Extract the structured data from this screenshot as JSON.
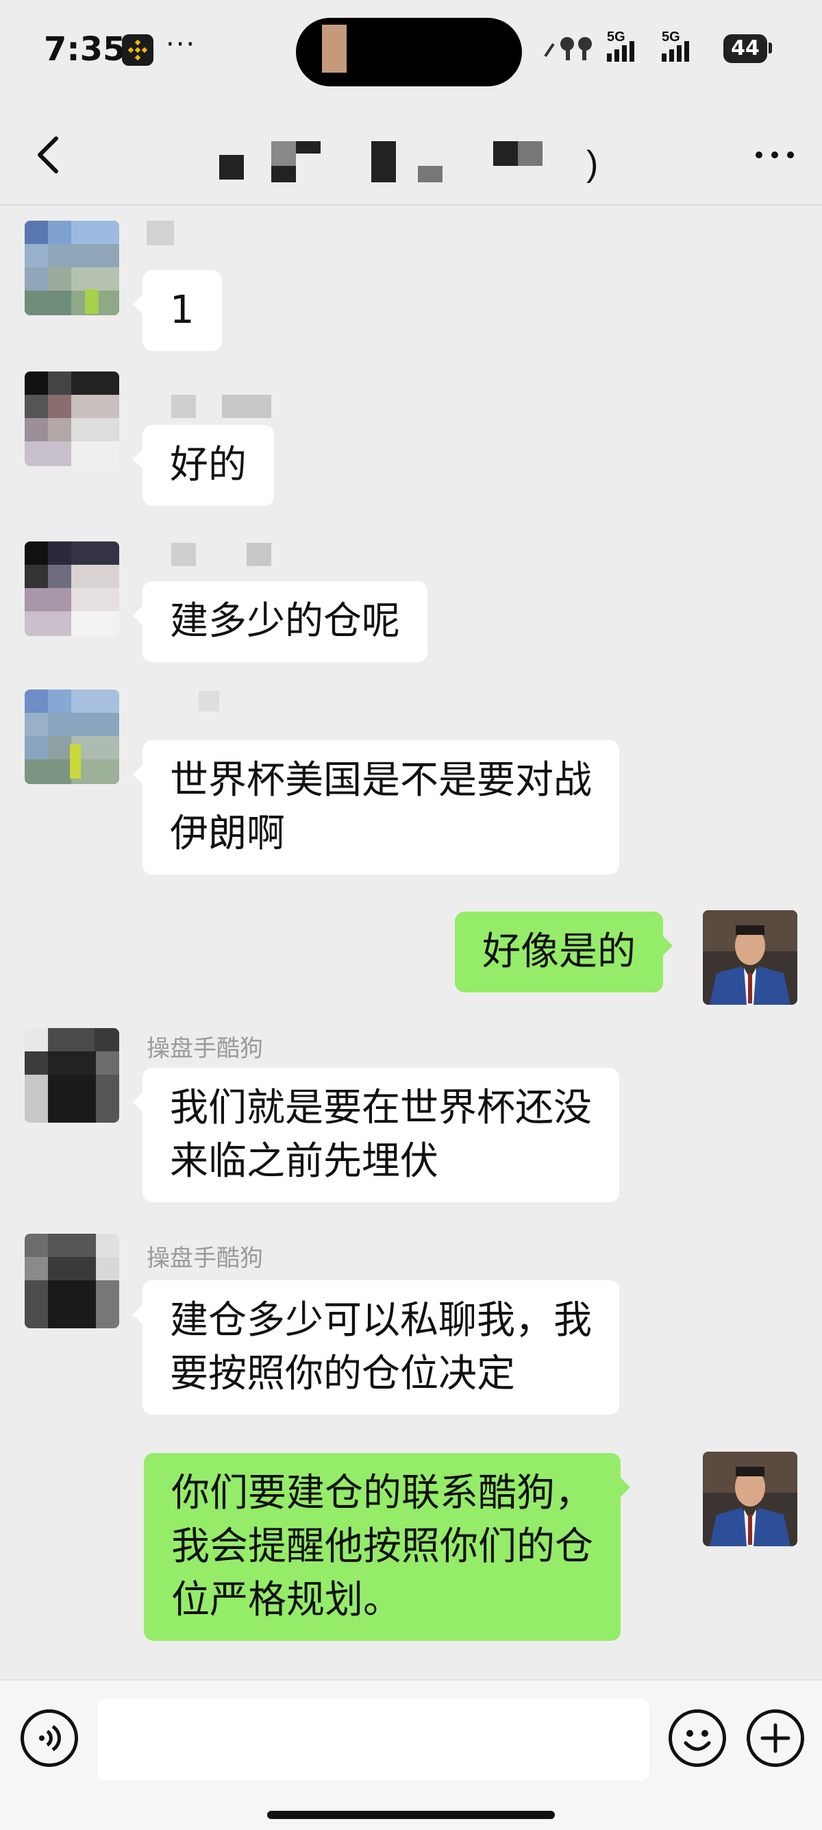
{
  "status_bar": {
    "time": "7:35",
    "more_dots": "···",
    "network_1": "5G",
    "network_2": "5G",
    "battery": "44"
  },
  "nav": {
    "more_label": "···"
  },
  "messages": [
    {
      "side": "in",
      "sender": "",
      "text_lines": [
        "1"
      ]
    },
    {
      "side": "in",
      "sender": "",
      "text_lines": [
        "好的"
      ]
    },
    {
      "side": "in",
      "sender": "",
      "text_lines": [
        "建多少的仓呢"
      ]
    },
    {
      "side": "in",
      "sender": "",
      "text_lines": [
        "世界杯美国是不是要对战",
        "伊朗啊"
      ]
    },
    {
      "side": "out",
      "sender": "",
      "text_lines": [
        "好像是的"
      ]
    },
    {
      "side": "in",
      "sender": "操盘手酷狗",
      "text_lines": [
        "我们就是要在世界杯还没",
        "来临之前先埋伏"
      ]
    },
    {
      "side": "in",
      "sender": "操盘手酷狗",
      "text_lines": [
        "建仓多少可以私聊我，我",
        "要按照你的仓位决定"
      ]
    },
    {
      "side": "out",
      "sender": "",
      "text_lines": [
        "你们要建仓的联系酷狗，",
        "我会提醒他按照你们的仓",
        "位严格规划。"
      ]
    }
  ],
  "input": {
    "placeholder": ""
  },
  "colors": {
    "background": "#ededed",
    "incoming_bubble": "#ffffff",
    "outgoing_bubble": "#95ec69",
    "sender_name": "#9a9a9a"
  },
  "icons": [
    "binance-icon",
    "airpods-icon",
    "signal-icon",
    "battery-icon",
    "back-arrow-icon",
    "more-icon",
    "voice-icon",
    "emoji-icon",
    "plus-icon"
  ]
}
